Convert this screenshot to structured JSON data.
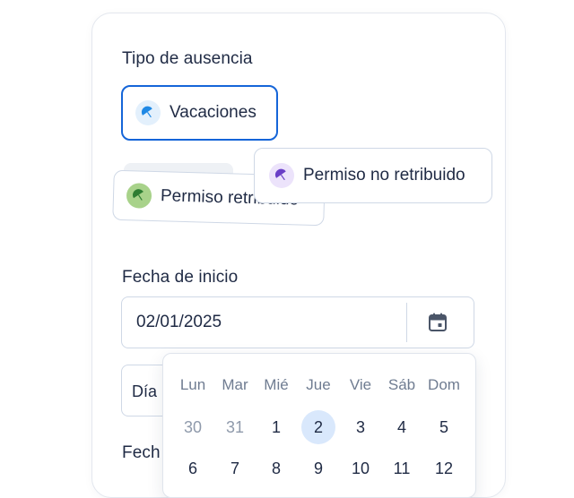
{
  "absence": {
    "label": "Tipo de ausencia",
    "options": [
      {
        "label": "Vacaciones",
        "icon": "umbrella-icon",
        "color": "#1e88e5",
        "bg": "#e3f0fc",
        "selected": true
      },
      {
        "label": "Permiso retribuido",
        "icon": "umbrella-icon",
        "color": "#2e7d32",
        "bg": "#a8d28a",
        "selected": false
      },
      {
        "label": "Permiso no retribuido",
        "icon": "umbrella-icon",
        "color": "#6a3fc7",
        "bg": "#ece3fb",
        "selected": false
      }
    ]
  },
  "start": {
    "label": "Fecha de inicio",
    "value": "02/01/2025",
    "icon": "calendar-icon"
  },
  "day_field": {
    "placeholder": "Día"
  },
  "end": {
    "label_partial": "Fech"
  },
  "calendar": {
    "weekdays": [
      "Lun",
      "Mar",
      "Mié",
      "Jue",
      "Vie",
      "Sáb",
      "Dom"
    ],
    "row1": [
      "30",
      "31",
      "1",
      "2",
      "3",
      "4",
      "5"
    ],
    "row2": [
      "6",
      "7",
      "8",
      "9",
      "10",
      "11",
      "12"
    ],
    "selected_day": "2"
  },
  "colors": {
    "accent": "#1565d8",
    "text": "#1f2a44",
    "border": "#cfd8e6",
    "selected_day_bg": "#d9e8fc"
  }
}
